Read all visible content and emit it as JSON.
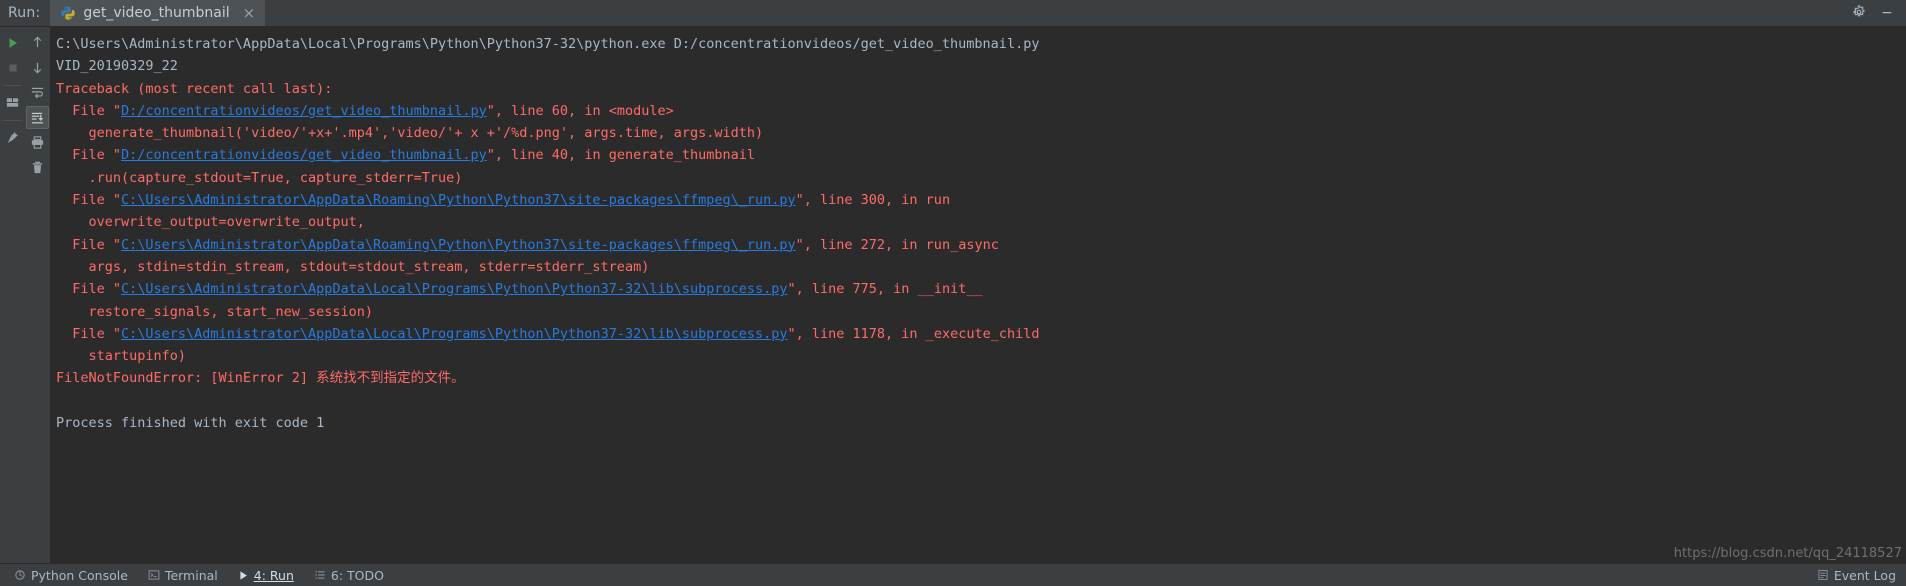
{
  "window": {
    "run_label": "Run:",
    "tab_title": "get_video_thumbnail",
    "tab_close": "×",
    "python_icon": "python-icon",
    "settings_icon": "gear-icon",
    "minimize_icon": "minimize-icon"
  },
  "toolbar_left": {
    "items": [
      {
        "name": "rerun-button",
        "icon": "play-icon",
        "title": "Rerun"
      },
      {
        "name": "stop-button",
        "icon": "stop-square-icon",
        "title": "Stop"
      },
      {
        "name": "layout-button",
        "icon": "layout-icon",
        "title": "Layout"
      },
      {
        "name": "pin-button",
        "icon": "pin-icon",
        "title": "Pin Tab"
      }
    ]
  },
  "toolbar_console": {
    "items": [
      {
        "name": "up-the-stack-button",
        "icon": "arrow-up-icon",
        "title": "Up the stack trace"
      },
      {
        "name": "down-the-stack-button",
        "icon": "arrow-down-icon",
        "title": "Down the stack trace"
      },
      {
        "name": "soft-wrap-button",
        "icon": "soft-wrap-icon",
        "title": "Use Soft Wraps"
      },
      {
        "name": "scroll-to-end-button",
        "icon": "scroll-to-end-icon",
        "title": "Scroll to the end",
        "active": true
      },
      {
        "name": "print-button",
        "icon": "printer-icon",
        "title": "Print"
      },
      {
        "name": "clear-all-button",
        "icon": "trash-icon",
        "title": "Clear All"
      }
    ]
  },
  "console": {
    "lines": [
      {
        "segments": [
          {
            "text": "C:\\Users\\Administrator\\AppData\\Local\\Programs\\Python\\Python37-32\\python.exe D:/concentrationvideos/get_video_thumbnail.py",
            "style": "normal"
          }
        ]
      },
      {
        "segments": [
          {
            "text": "VID_20190329_22",
            "style": "normal"
          }
        ]
      },
      {
        "segments": [
          {
            "text": "Traceback (most recent call last):",
            "style": "error"
          }
        ]
      },
      {
        "segments": [
          {
            "text": "  File \"",
            "style": "error"
          },
          {
            "text": "D:/concentrationvideos/get_video_thumbnail.py",
            "style": "link"
          },
          {
            "text": "\", line 60, in <module>",
            "style": "error"
          }
        ]
      },
      {
        "segments": [
          {
            "text": "    generate_thumbnail('video/'+x+'.mp4','video/'+ x +'/%d.png', args.time, args.width)",
            "style": "error"
          }
        ]
      },
      {
        "segments": [
          {
            "text": "  File \"",
            "style": "error"
          },
          {
            "text": "D:/concentrationvideos/get_video_thumbnail.py",
            "style": "link"
          },
          {
            "text": "\", line 40, in generate_thumbnail",
            "style": "error"
          }
        ]
      },
      {
        "segments": [
          {
            "text": "    .run(capture_stdout=True, capture_stderr=True)",
            "style": "error"
          }
        ]
      },
      {
        "segments": [
          {
            "text": "  File \"",
            "style": "error"
          },
          {
            "text": "C:\\Users\\Administrator\\AppData\\Roaming\\Python\\Python37\\site-packages\\ffmpeg\\_run.py",
            "style": "link"
          },
          {
            "text": "\", line 300, in run",
            "style": "error"
          }
        ]
      },
      {
        "segments": [
          {
            "text": "    overwrite_output=overwrite_output,",
            "style": "error"
          }
        ]
      },
      {
        "segments": [
          {
            "text": "  File \"",
            "style": "error"
          },
          {
            "text": "C:\\Users\\Administrator\\AppData\\Roaming\\Python\\Python37\\site-packages\\ffmpeg\\_run.py",
            "style": "link"
          },
          {
            "text": "\", line 272, in run_async",
            "style": "error"
          }
        ]
      },
      {
        "segments": [
          {
            "text": "    args, stdin=stdin_stream, stdout=stdout_stream, stderr=stderr_stream)",
            "style": "error"
          }
        ]
      },
      {
        "segments": [
          {
            "text": "  File \"",
            "style": "error"
          },
          {
            "text": "C:\\Users\\Administrator\\AppData\\Local\\Programs\\Python\\Python37-32\\lib\\subprocess.py",
            "style": "link"
          },
          {
            "text": "\", line 775, in __init__",
            "style": "error"
          }
        ]
      },
      {
        "segments": [
          {
            "text": "    restore_signals, start_new_session)",
            "style": "error"
          }
        ]
      },
      {
        "segments": [
          {
            "text": "  File \"",
            "style": "error"
          },
          {
            "text": "C:\\Users\\Administrator\\AppData\\Local\\Programs\\Python\\Python37-32\\lib\\subprocess.py",
            "style": "link"
          },
          {
            "text": "\", line 1178, in _execute_child",
            "style": "error"
          }
        ]
      },
      {
        "segments": [
          {
            "text": "    startupinfo)",
            "style": "error"
          }
        ]
      },
      {
        "segments": [
          {
            "text": "FileNotFoundError: [WinError 2] 系统找不到指定的文件。",
            "style": "error"
          }
        ]
      },
      {
        "segments": [
          {
            "text": " ",
            "style": "normal"
          }
        ]
      },
      {
        "segments": [
          {
            "text": "Process finished with exit code 1",
            "style": "normal"
          }
        ]
      }
    ],
    "watermark": "https://blog.csdn.net/qq_24118527"
  },
  "statusbar": {
    "items": [
      {
        "name": "status-python-console",
        "label": "Python Console",
        "icon": "python-console-icon",
        "active": false
      },
      {
        "name": "status-terminal",
        "label": "Terminal",
        "icon": "terminal-icon",
        "active": false
      },
      {
        "name": "status-run",
        "label": "4: Run",
        "icon": "run-icon",
        "active": true
      },
      {
        "name": "status-todo",
        "label": "6: TODO",
        "icon": "todo-icon",
        "active": false
      }
    ],
    "event_log": {
      "label": "Event Log",
      "icon": "event-log-icon"
    }
  },
  "colors": {
    "chrome": "#3c3f41",
    "console_bg": "#2b2b2b",
    "text": "#a9b7c6",
    "error": "#ff6b68",
    "link": "#287bde",
    "tab_active": "#4e5254",
    "accent_green": "#499c54"
  }
}
